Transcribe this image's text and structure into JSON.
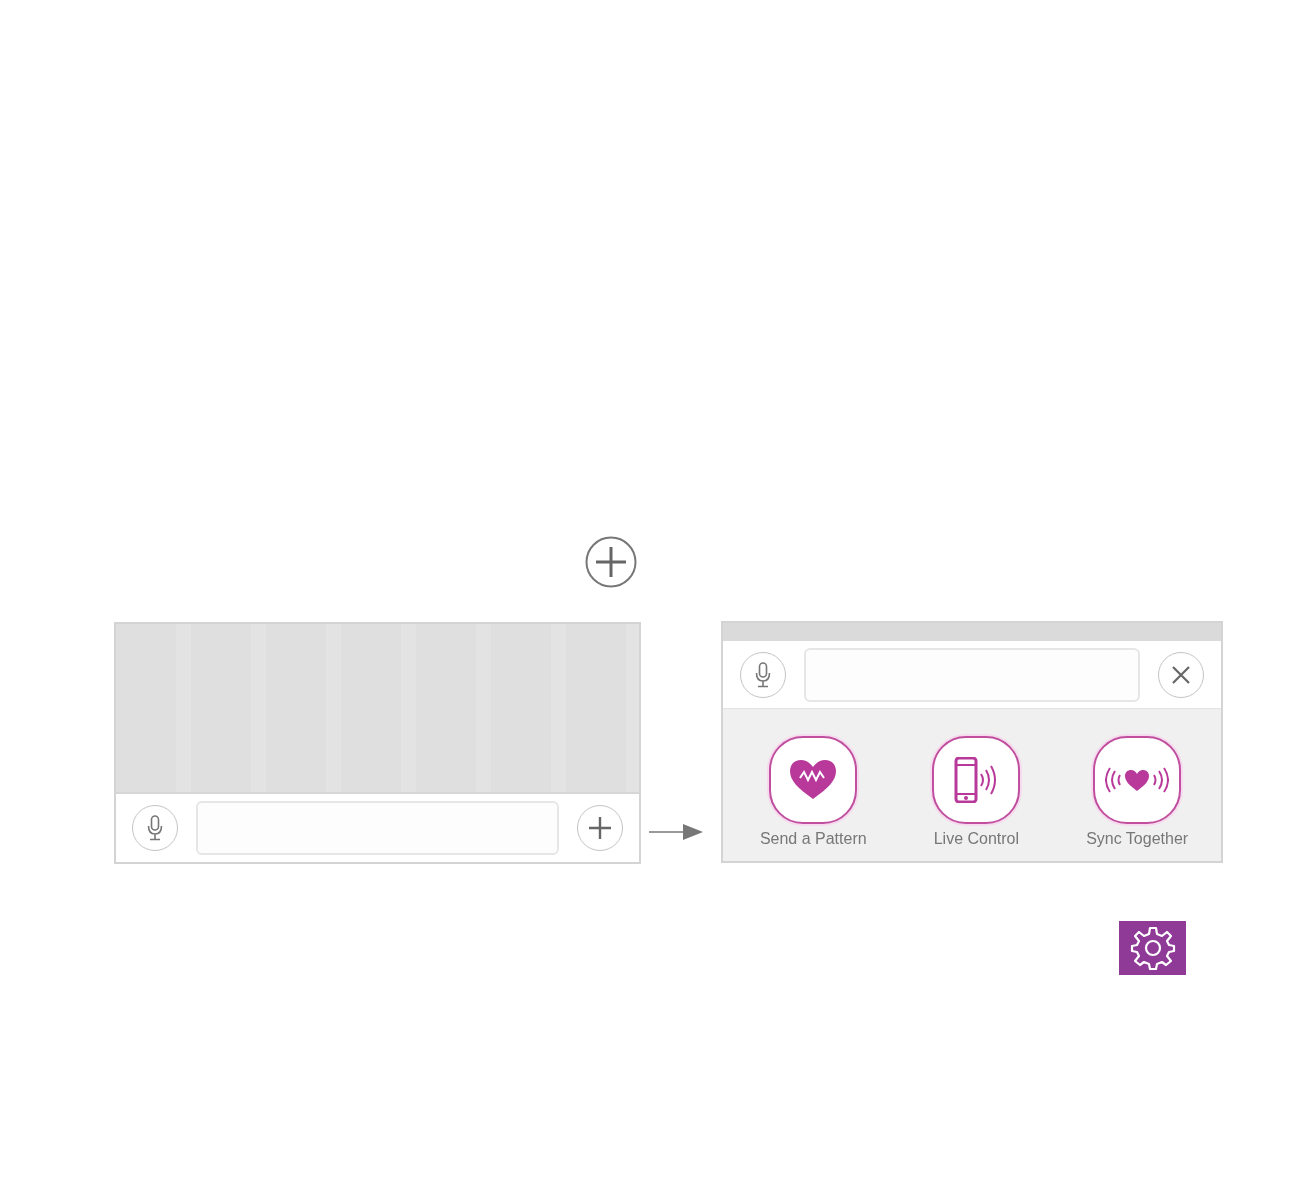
{
  "menu": {
    "actions": [
      {
        "label": "Send a Pattern",
        "kind": "pattern"
      },
      {
        "label": "Live Control",
        "kind": "phone"
      },
      {
        "label": "Sync Together",
        "kind": "sync"
      }
    ]
  }
}
